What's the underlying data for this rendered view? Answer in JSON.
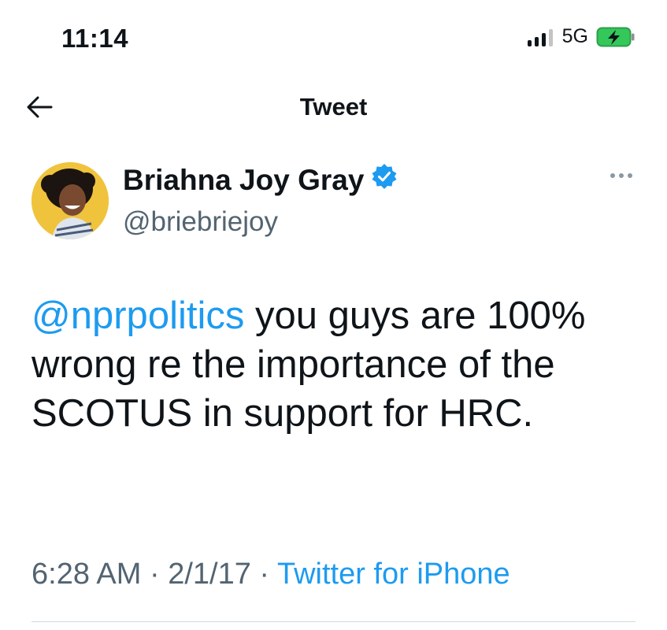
{
  "status_bar": {
    "time": "11:14",
    "network": "5G",
    "signal_bars_active": 3,
    "signal_bars_total": 4,
    "battery_charging": true,
    "battery_color": "#34c759"
  },
  "header": {
    "title": "Tweet"
  },
  "author": {
    "name": "Briahna Joy Gray",
    "handle": "@briebriejoy",
    "verified": true
  },
  "tweet": {
    "mention": "@nprpolitics",
    "text": " you guys are 100% wrong re the importance of the SCOTUS in support for HRC."
  },
  "meta": {
    "time": "6:28 AM",
    "separator": " · ",
    "date": "2/1/17",
    "source": "Twitter for iPhone"
  },
  "colors": {
    "link": "#1d9bf0",
    "secondary_text": "#536471",
    "verified_badge": "#1d9bf0",
    "avatar_background": "#f0c33c"
  }
}
